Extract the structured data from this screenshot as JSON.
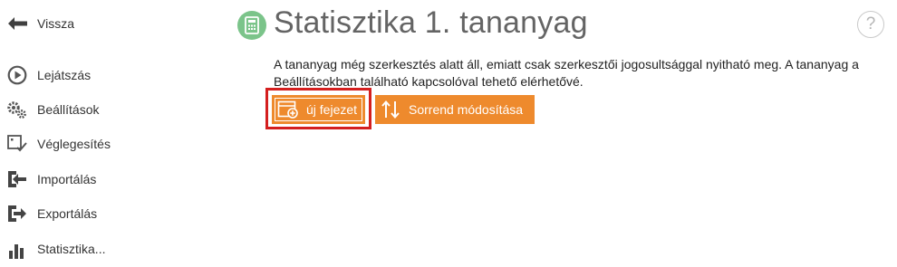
{
  "sidebar": {
    "back_label": "Vissza",
    "items": [
      {
        "label": "Lejátszás",
        "icon": "play-circle-icon"
      },
      {
        "label": "Beállítások",
        "icon": "gears-icon"
      },
      {
        "label": "Véglegesítés",
        "icon": "finalize-icon"
      },
      {
        "label": "Importálás",
        "icon": "import-icon"
      },
      {
        "label": "Exportálás",
        "icon": "export-icon"
      },
      {
        "label": "Statisztika...",
        "icon": "bar-chart-icon"
      }
    ]
  },
  "header": {
    "title": "Statisztika 1. tananyag",
    "icon": "calculator-icon",
    "help_label": "?"
  },
  "notice_text": "A tananyag még szerkesztés alatt áll, emiatt csak szerkesztői jogosultsággal nyitható meg. A tananyag a Beállításokban található kapcsolóval tehető elérhetővé.",
  "toolbar": {
    "new_chapter_label": "új fejezet",
    "reorder_label": "Sorrend módosítása"
  },
  "colors": {
    "accent_orange": "#ee8a2d",
    "header_icon_green": "#7bc48a",
    "highlight_red": "#d41f1f",
    "title_gray": "#646464"
  }
}
